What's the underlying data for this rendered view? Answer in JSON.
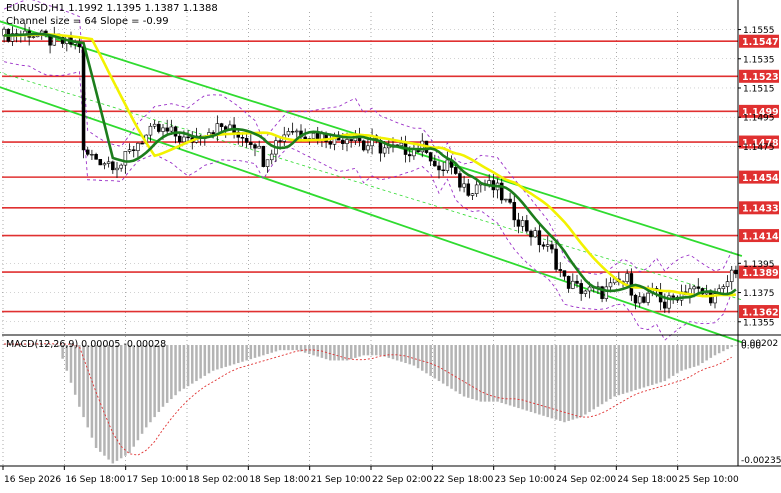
{
  "chart_data": {
    "type": "candlestick",
    "header": {
      "symbol_line": "EURUSD,H1  1.1992 1.1395 1.1387 1.1388",
      "channel_line": "Channel size = 64 Slope = -0.99"
    },
    "price_axis": {
      "min": 1.1348,
      "max": 1.1567,
      "tick_labels": [
        "1.1555",
        "1.1535",
        "1.1515",
        "1.1495",
        "1.1475",
        "1.1395",
        "1.1375",
        "1.1355"
      ],
      "tick_values": [
        1.1555,
        1.1535,
        1.1515,
        1.1495,
        1.1475,
        1.1395,
        1.1375,
        1.1355
      ]
    },
    "levels": [
      {
        "label": "1.1547",
        "value": 1.1547
      },
      {
        "label": "1.1523",
        "value": 1.1523
      },
      {
        "label": "1.1499",
        "value": 1.1499
      },
      {
        "label": "1.1478",
        "value": 1.1478
      },
      {
        "label": "1.1454",
        "value": 1.1454
      },
      {
        "label": "1.1433",
        "value": 1.1433
      },
      {
        "label": "1.1414",
        "value": 1.1414
      },
      {
        "label": "1.1389",
        "value": 1.1389
      },
      {
        "label": "1.1362",
        "value": 1.1362
      }
    ],
    "time_labels": [
      "16 Sep 2026",
      "16 Sep 18:00",
      "17 Sep 10:00",
      "18 Sep 02:00",
      "18 Sep 18:00",
      "21 Sep 10:00",
      "22 Sep 02:00",
      "22 Sep 18:00",
      "23 Sep 10:00",
      "24 Sep 02:00",
      "24 Sep 18:00",
      "25 Sep 10:00"
    ],
    "candle_count": 176,
    "price_path": [
      [
        0,
        1.1551
      ],
      [
        6,
        1.1553
      ],
      [
        10,
        1.1548
      ],
      [
        14,
        1.1546
      ],
      [
        18,
        1.1545
      ],
      [
        19,
        1.147
      ],
      [
        24,
        1.1465
      ],
      [
        28,
        1.1463
      ],
      [
        32,
        1.1478
      ],
      [
        36,
        1.1486
      ],
      [
        40,
        1.1484
      ],
      [
        44,
        1.1478
      ],
      [
        48,
        1.1486
      ],
      [
        52,
        1.1488
      ],
      [
        56,
        1.1484
      ],
      [
        60,
        1.1478
      ],
      [
        62,
        1.1466
      ],
      [
        65,
        1.1478
      ],
      [
        68,
        1.1487
      ],
      [
        72,
        1.1484
      ],
      [
        76,
        1.1482
      ],
      [
        80,
        1.148
      ],
      [
        84,
        1.1484
      ],
      [
        86,
        1.1474
      ],
      [
        88,
        1.1478
      ],
      [
        90,
        1.1474
      ],
      [
        94,
        1.1473
      ],
      [
        98,
        1.1473
      ],
      [
        101,
        1.1475
      ],
      [
        104,
        1.1455
      ],
      [
        106,
        1.1465
      ],
      [
        108,
        1.1452
      ],
      [
        111,
        1.1446
      ],
      [
        114,
        1.145
      ],
      [
        118,
        1.1445
      ],
      [
        121,
        1.1432
      ],
      [
        124,
        1.1422
      ],
      [
        128,
        1.141
      ],
      [
        131,
        1.1402
      ],
      [
        134,
        1.1383
      ],
      [
        137,
        1.1378
      ],
      [
        140,
        1.1376
      ],
      [
        143,
        1.1375
      ],
      [
        146,
        1.138
      ],
      [
        149,
        1.1384
      ],
      [
        151,
        1.1372
      ],
      [
        153,
        1.1368
      ],
      [
        156,
        1.1376
      ],
      [
        158,
        1.1366
      ],
      [
        161,
        1.1374
      ],
      [
        164,
        1.1378
      ],
      [
        167,
        1.1374
      ],
      [
        170,
        1.1372
      ],
      [
        172,
        1.1376
      ],
      [
        174,
        1.1389
      ],
      [
        175,
        1.1391
      ]
    ],
    "channel": {
      "upper": [
        [
          0,
          1.1561
        ],
        [
          175,
          1.14
        ]
      ],
      "middle": [
        [
          0,
          1.1526
        ],
        [
          175,
          1.137
        ]
      ],
      "lower": [
        [
          0,
          1.1516
        ],
        [
          175,
          1.1341
        ]
      ]
    },
    "ma_colors": {
      "fast": "#1c7d1c",
      "slow": "#f2f200",
      "channel": "#2fdb2f",
      "level": "#e03030",
      "bands": "#9b30c8"
    },
    "macd": {
      "label": "MACD(12,26,9) 0.00005 -0.00028",
      "axis_labels": [
        "0.00202",
        "0.00",
        "-0.00235"
      ],
      "axis_values": [
        0.00202,
        0.0,
        -0.00235
      ],
      "histogram": [
        [
          0,
          0.0003
        ],
        [
          6,
          0.0004
        ],
        [
          12,
          0.0002
        ],
        [
          18,
          -0.0012
        ],
        [
          22,
          -0.002
        ],
        [
          26,
          -0.0023
        ],
        [
          30,
          -0.0021
        ],
        [
          34,
          -0.0016
        ],
        [
          38,
          -0.0012
        ],
        [
          42,
          -0.0009
        ],
        [
          46,
          -0.0007
        ],
        [
          50,
          -0.0005
        ],
        [
          54,
          -0.0004
        ],
        [
          58,
          -0.0003
        ],
        [
          62,
          -0.0002
        ],
        [
          66,
          -0.0001
        ],
        [
          70,
          -0.0001
        ],
        [
          74,
          -0.0002
        ],
        [
          78,
          -0.0003
        ],
        [
          82,
          -0.0003
        ],
        [
          86,
          -0.0002
        ],
        [
          90,
          -0.0002
        ],
        [
          94,
          -0.0003
        ],
        [
          98,
          -0.0004
        ],
        [
          102,
          -0.0006
        ],
        [
          106,
          -0.0008
        ],
        [
          110,
          -0.001
        ],
        [
          114,
          -0.0011
        ],
        [
          118,
          -0.0011
        ],
        [
          122,
          -0.0012
        ],
        [
          126,
          -0.0013
        ],
        [
          130,
          -0.0014
        ],
        [
          134,
          -0.0015
        ],
        [
          138,
          -0.0014
        ],
        [
          142,
          -0.0012
        ],
        [
          146,
          -0.001
        ],
        [
          150,
          -0.0009
        ],
        [
          154,
          -0.0008
        ],
        [
          158,
          -0.0007
        ],
        [
          162,
          -0.0005
        ],
        [
          166,
          -0.0004
        ],
        [
          170,
          -0.0002
        ],
        [
          175,
          0.0
        ]
      ]
    }
  }
}
